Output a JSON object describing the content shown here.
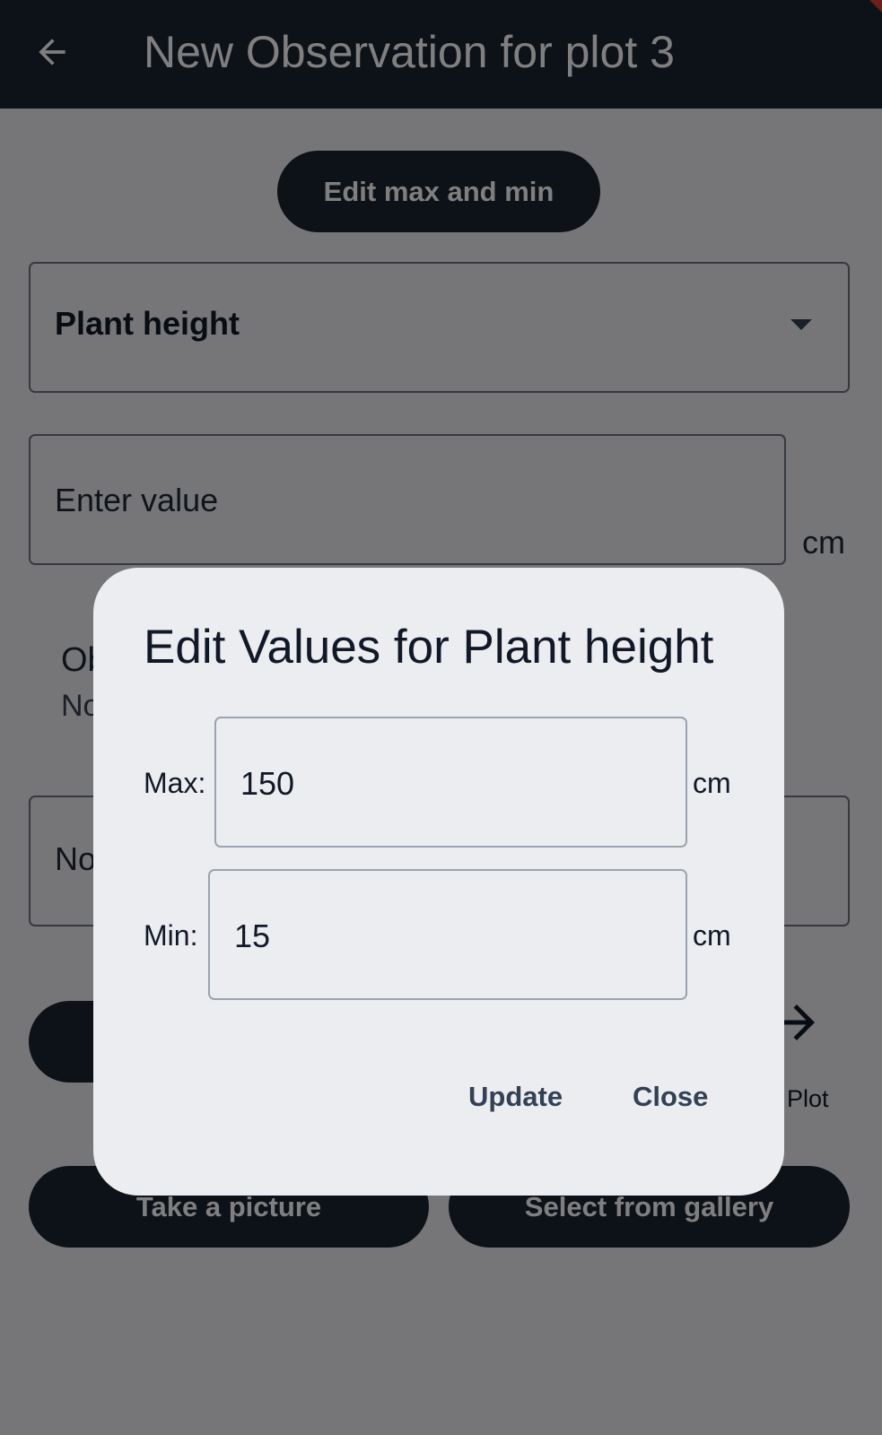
{
  "appbar": {
    "title": "New Observation for plot 3",
    "back_icon": "arrow-left-icon",
    "background": "#1b2331"
  },
  "form": {
    "edit_button_label": "Edit max and min",
    "trait_dropdown": {
      "selected": "Plant height",
      "icon": "caret-down-icon"
    },
    "value_field": {
      "placeholder": "Enter value",
      "unit": "cm"
    },
    "observation": {
      "title_partial": "Ob",
      "subtitle_partial": "No"
    },
    "notes_field": {
      "placeholder_partial": "No"
    },
    "next_plot": {
      "label_partial": "t Plot",
      "icon": "arrow-right-icon"
    },
    "take_picture_label": "Take a picture",
    "gallery_label": "Select from gallery"
  },
  "dialog": {
    "title": "Edit Values for Plant height",
    "max": {
      "label": "Max:",
      "value": "150",
      "unit": "cm"
    },
    "min": {
      "label": "Min:",
      "value": "15",
      "unit": "cm"
    },
    "update_label": "Update",
    "close_label": "Close"
  },
  "colors": {
    "primary_dark": "#1b2331",
    "surface": "#ecedf0",
    "action_text": "#334155",
    "scrim": "rgba(0,0,0,0.50)"
  }
}
